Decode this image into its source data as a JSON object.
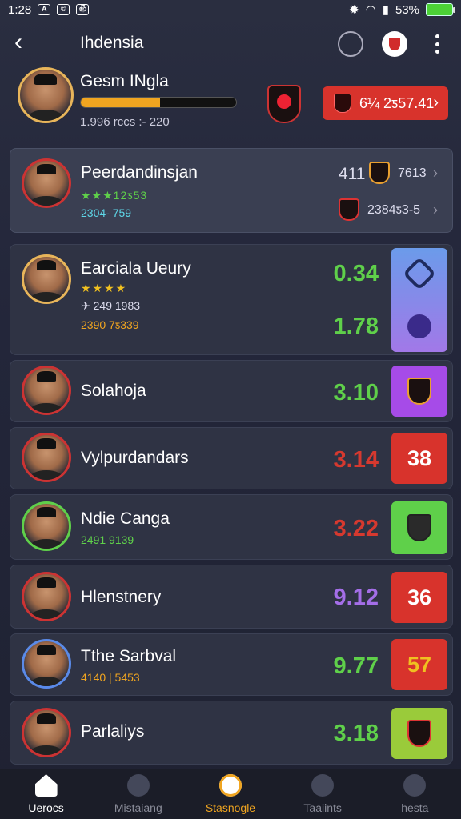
{
  "status_bar": {
    "time": "1:28",
    "battery_text": "53%",
    "notif_icons": [
      "A",
      "©",
      "෯"
    ]
  },
  "header": {
    "title": "Ihdensia",
    "back_icon": "back-arrow-icon",
    "actions": [
      "cloud-icon",
      "club-badge-icon",
      "more-vertical-icon"
    ]
  },
  "profile": {
    "name": "Gesm INgla",
    "stats": "1.996 rccs :- 220",
    "progress": 0.51,
    "coin_value": "6¼ 2ƽ57.41"
  },
  "featured": {
    "name": "Peerdandinsjan",
    "stars": "★★★12ƽ53",
    "sub": "2304- 759",
    "top_value": "411",
    "top_right": "7613",
    "bottom_right": "2384ƽ3-5"
  },
  "players": [
    {
      "name": "Earciala Ueury",
      "stars": "★★★★",
      "line1": "✈ 249 1983",
      "line2": "2390 7ƽ339",
      "rating": "0.34",
      "rating2": "1.78",
      "rating_color": "green",
      "tile": ""
    },
    {
      "name": "Solahoja",
      "rating": "3.10",
      "rating_color": "green",
      "tile": ""
    },
    {
      "name": "Vylpurdandars",
      "rating": "3.14",
      "rating_color": "red",
      "tile": "38"
    },
    {
      "name": "Ndie Canga",
      "line1": "2491 9139",
      "rating": "3.22",
      "rating_color": "red",
      "tile": ""
    },
    {
      "name": "Hlenstnery",
      "rating": "9.12",
      "rating_color": "purple",
      "tile": "36"
    },
    {
      "name": "Tthe Sarbval",
      "line1": "4140 | 5453",
      "rating": "9.77",
      "rating_color": "green",
      "tile": "57"
    },
    {
      "name": "Parlaliys",
      "rating": "3.18",
      "rating_color": "green",
      "tile": ""
    }
  ],
  "bottom_nav": [
    {
      "label": "Uerocs",
      "icon": "home-icon"
    },
    {
      "label": "Mistaiang",
      "icon": "arrow-up-icon"
    },
    {
      "label": "Stasnogle",
      "icon": "target-icon"
    },
    {
      "label": "Taaiints",
      "icon": "user-icon"
    },
    {
      "label": "hesta",
      "icon": "profile-icon"
    }
  ],
  "colors": {
    "accent_orange": "#f0a520",
    "red": "#d6392f",
    "green": "#5fd04a",
    "purple": "#a46ee8"
  }
}
